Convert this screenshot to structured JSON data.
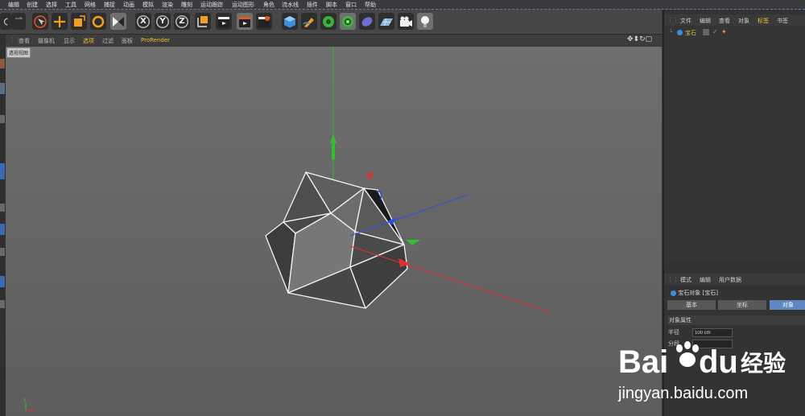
{
  "menubar": {
    "items": [
      "编辑",
      "创建",
      "选择",
      "工具",
      "网格",
      "捕捉",
      "动画",
      "模拟",
      "渲染",
      "雕刻",
      "运动跟踪",
      "运动图形",
      "角色",
      "流水线",
      "插件",
      "脚本",
      "窗口",
      "帮助"
    ]
  },
  "toolbar": {
    "axis_x": "X",
    "axis_y": "Y",
    "axis_z": "Z"
  },
  "viewport_menu": {
    "items": [
      "查看",
      "摄像机",
      "显示",
      "选项",
      "过滤",
      "面板",
      "ProRender"
    ],
    "label": "透视视图",
    "prorender_color": "#f0c030"
  },
  "object_manager": {
    "tabs": [
      "文件",
      "编辑",
      "查看",
      "对象",
      "标签",
      "书签"
    ],
    "object_name": "宝石"
  },
  "attribute_manager": {
    "tabs_head": [
      "模式",
      "编辑",
      "用户数据"
    ],
    "object_title": "宝石对象 [宝石]",
    "tabs": [
      "基本",
      "坐标",
      "对象"
    ],
    "section": "对象属性",
    "fields": [
      {
        "label": "半径",
        "value": "100 cm"
      },
      {
        "label": "分段",
        "value": ""
      }
    ]
  },
  "watermark": {
    "brand_1": "Bai",
    "brand_2": "du",
    "brand_3": "经验",
    "url": "jingyan.baidu.com"
  },
  "colors": {
    "accent_blue": "#5e87c3",
    "axis_x": "#e03030",
    "axis_y": "#30c030",
    "axis_z": "#3050e0"
  }
}
